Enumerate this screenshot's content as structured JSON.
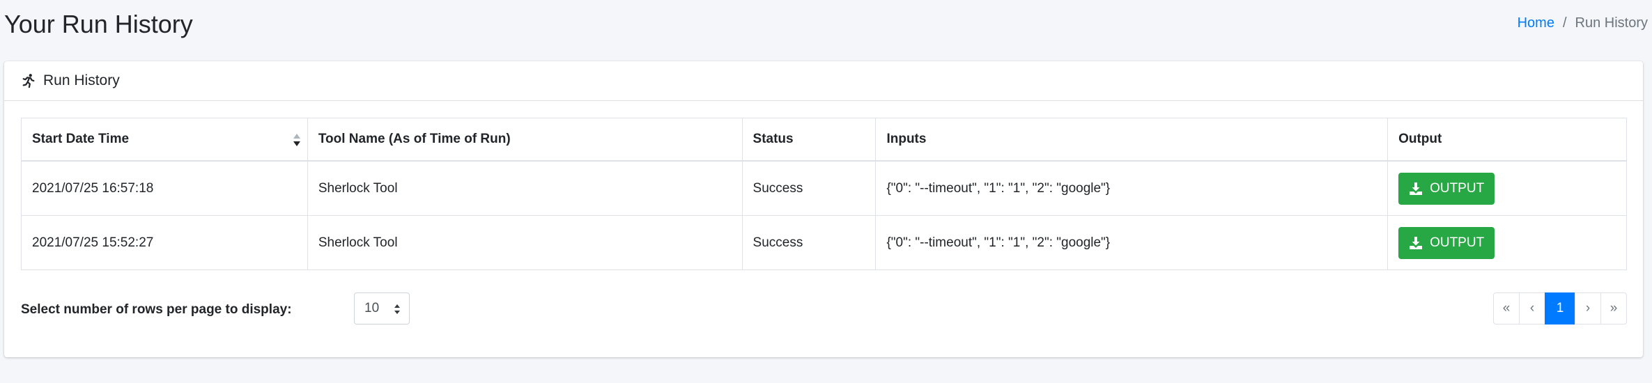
{
  "page": {
    "title": "Your Run History"
  },
  "breadcrumb": {
    "home": "Home",
    "separator": "/",
    "current": "Run History"
  },
  "card": {
    "title": "Run History",
    "icon": "running-icon"
  },
  "table": {
    "headers": [
      "Start Date Time",
      "Tool Name (As of Time of Run)",
      "Status",
      "Inputs",
      "Output"
    ],
    "rows": [
      {
        "start": "2021/07/25 16:57:18",
        "tool": "Sherlock Tool",
        "status": "Success",
        "inputs": "{\"0\": \"--timeout\", \"1\": \"1\", \"2\": \"google\"}",
        "output_label": "OUTPUT"
      },
      {
        "start": "2021/07/25 15:52:27",
        "tool": "Sherlock Tool",
        "status": "Success",
        "inputs": "{\"0\": \"--timeout\", \"1\": \"1\", \"2\": \"google\"}",
        "output_label": "OUTPUT"
      }
    ]
  },
  "rows_per_page": {
    "label": "Select number of rows per page to display:",
    "value": "10"
  },
  "pagination": {
    "first": "«",
    "prev": "‹",
    "current": "1",
    "next": "›",
    "last": "»"
  },
  "colors": {
    "primary": "#007bff",
    "success": "#28a745",
    "background": "#f4f6f9"
  }
}
